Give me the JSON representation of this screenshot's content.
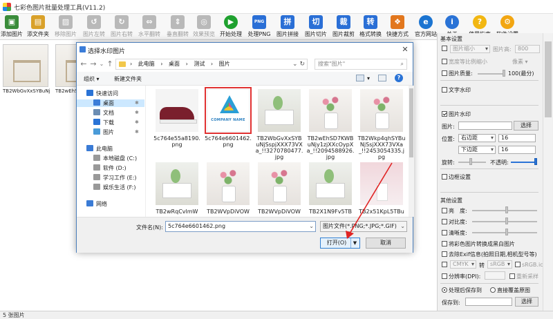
{
  "app": {
    "title": "七彩色图片批量处理工具(V11.2)"
  },
  "toolbar": [
    {
      "label": "添加图片",
      "glyph": "▣",
      "color": "#3a8c3a",
      "enabled": true
    },
    {
      "label": "添文件夹",
      "glyph": "▤",
      "color": "#d9a12a",
      "enabled": true
    },
    {
      "label": "移除图片",
      "glyph": "▨",
      "color": "#999",
      "enabled": false
    },
    {
      "label": "图片左转",
      "glyph": "↺",
      "color": "#999",
      "enabled": false
    },
    {
      "label": "图片右转",
      "glyph": "↻",
      "color": "#999",
      "enabled": false
    },
    {
      "label": "水平翻转",
      "glyph": "⇔",
      "color": "#999",
      "enabled": false
    },
    {
      "label": "垂直翻转",
      "glyph": "⇕",
      "color": "#999",
      "enabled": false
    },
    {
      "label": "效果预览",
      "glyph": "◎",
      "color": "#999",
      "enabled": false
    },
    {
      "label": "开始处理",
      "glyph": "▶",
      "color": "#1fa12f",
      "enabled": true
    },
    {
      "label": "处理PNG",
      "glyph": "PNG",
      "color": "#2a6fd6",
      "enabled": true
    },
    {
      "label": "图片拼接",
      "glyph": "拼",
      "color": "#2a6fd6",
      "enabled": true
    },
    {
      "label": "图片切片",
      "glyph": "切",
      "color": "#2a6fd6",
      "enabled": true
    },
    {
      "label": "图片裁剪",
      "glyph": "裁",
      "color": "#2a6fd6",
      "enabled": true
    },
    {
      "label": "格式转换",
      "glyph": "转",
      "color": "#2a6fd6",
      "enabled": true
    },
    {
      "label": "快捷方式",
      "glyph": "❖",
      "color": "#e2771e",
      "enabled": true
    },
    {
      "label": "官方网站",
      "glyph": "e",
      "color": "#1b74d1",
      "enabled": true
    },
    {
      "label": "关于",
      "glyph": "i",
      "color": "#2a73d6",
      "enabled": true
    },
    {
      "label": "使用指南",
      "glyph": "?",
      "color": "#f2b712",
      "enabled": true
    },
    {
      "label": "软件设置",
      "glyph": "⚙",
      "color": "#f2a612",
      "enabled": true
    }
  ],
  "thumbnails": [
    {
      "caption": "TB2WbGvXxSYBuNjS..."
    },
    {
      "caption": "TB2wEhSD..."
    }
  ],
  "status": {
    "text": "5 张图片"
  },
  "panel": {
    "basic_title": "基本设置",
    "scale_label": "图片缩小",
    "height_label": "图片高:",
    "height_value": "800",
    "ratio_label": "宽度等比例缩小",
    "unit_label": "像素",
    "quality_label": "图片质量:",
    "quality_value": "100(最分)",
    "text_wm": "文字水印",
    "image_wm": "图片水印",
    "pic_label": "图片:",
    "select_btn": "选择",
    "pos_label": "位置:",
    "pos_h": "右边距",
    "pos_h_val": "16",
    "pos_v": "下边距",
    "pos_v_val": "16",
    "rotate_label": "旋转:",
    "opacity_label": "不透明:",
    "border_title": "边框设置",
    "other_title": "其他设置",
    "brightness": "亮　度:",
    "contrast": "对比度:",
    "sharpness": "清晰度:",
    "grayscale": "将彩色图片转换成黑白图片",
    "exif": "去除Exif信息(拍照日期,相机型号等)",
    "cmyk": "CMYK",
    "to_label": "转",
    "srgb": "sRGB",
    "srgb_icc": "sRGB.icc",
    "dpi": "分辨率(DPI):",
    "resample": "重新采样",
    "save_after": "处理后保存到",
    "overwrite": "直接覆盖原图",
    "save_to": "保存到:",
    "save_select": "选择"
  },
  "dialog": {
    "title": "选择水印图片",
    "breadcrumb": [
      "此电脑",
      "桌面",
      "测试",
      "图片"
    ],
    "search_placeholder": "搜索\"图片\"",
    "organize": "组织 ▾",
    "new_folder": "新建文件夹",
    "nav": [
      {
        "label": "快速访问",
        "icon_color": "#2a73d6",
        "pinned": false
      },
      {
        "label": "桌面",
        "icon_color": "#3b7dd8",
        "pinned": true,
        "selected": true
      },
      {
        "label": "文档",
        "icon_color": "#6b8db3",
        "pinned": true
      },
      {
        "label": "下载",
        "icon_color": "#2a73d6",
        "pinned": true
      },
      {
        "label": "图片",
        "icon_color": "#4a9bd8",
        "pinned": true
      },
      {
        "label": "此电脑",
        "icon_color": "#3a7bd5",
        "pinned": false
      },
      {
        "label": "本地磁盘 (C:)",
        "icon_color": "#999",
        "pinned": false
      },
      {
        "label": "软件 (D:)",
        "icon_color": "#999",
        "pinned": false
      },
      {
        "label": "学习工作 (E:)",
        "icon_color": "#999",
        "pinned": false
      },
      {
        "label": "娱乐生活 (F:)",
        "icon_color": "#999",
        "pinned": false
      },
      {
        "label": "网络",
        "icon_color": "#3a7bd5",
        "pinned": false
      }
    ],
    "files": [
      {
        "name": "5c764e55a8190.png",
        "pic": "shoe"
      },
      {
        "name": "5c764e6601462.png",
        "pic": "logo",
        "selected": true,
        "logo_text": "COMPANY NAME"
      },
      {
        "name": "TB2WbGvXxSYBuNjSspjXXX73VXa_!!3270780477.jpg",
        "pic": "room"
      },
      {
        "name": "TB2wEhSD7KWBuNjy1zjXXcOypXa_!!2094588926.jpg",
        "pic": "vase"
      },
      {
        "name": "TB2Wkp4qhSYBuNjSsjXXX73VXa_!!2453054335.jpg",
        "pic": "vase"
      },
      {
        "name": "TB2wRqCvlmW",
        "pic": "room"
      },
      {
        "name": "TB2WVpDiVOW",
        "pic": "vase"
      },
      {
        "name": "TB2WVpDiVOW",
        "pic": "vase"
      },
      {
        "name": "TB2X1N9Fv5TB",
        "pic": "room"
      },
      {
        "name": "TB2x51KpL5TBu",
        "pic": "pink"
      }
    ],
    "filename_label": "文件名(N):",
    "filename_value": "5c764e6601462.png",
    "filetype": "图片文件(*.PNG;*.JPG;*.GIF)",
    "open": "打开(O)",
    "cancel": "取消"
  }
}
